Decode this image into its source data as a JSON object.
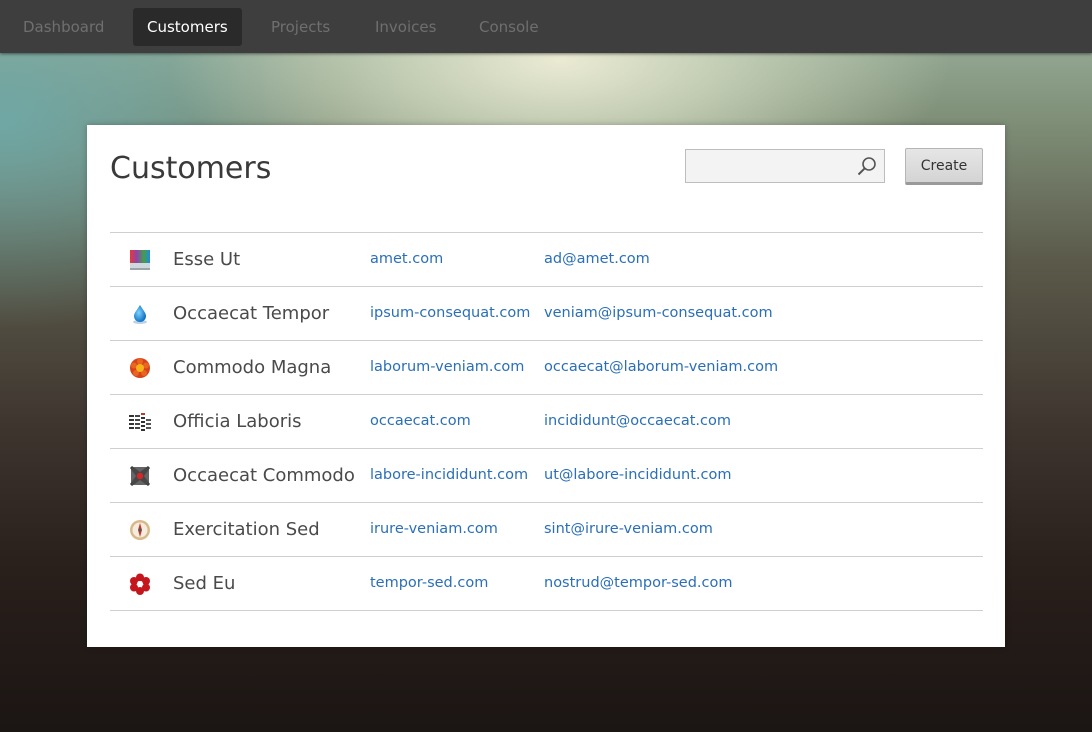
{
  "nav": {
    "items": [
      {
        "label": "Dashboard",
        "active": false
      },
      {
        "label": "Customers",
        "active": true
      },
      {
        "label": "Projects",
        "active": false
      },
      {
        "label": "Invoices",
        "active": false
      },
      {
        "label": "Console",
        "active": false
      }
    ]
  },
  "page": {
    "title": "Customers",
    "search": {
      "value": "",
      "placeholder": "",
      "icon": "search-icon"
    },
    "create_label": "Create"
  },
  "colors": {
    "link": "#2a6fb7",
    "nav_bg": "#3e3e3e",
    "nav_active_bg": "#2a2a2a"
  },
  "customers": [
    {
      "name": "Esse Ut",
      "website": "amet.com",
      "email": "ad@amet.com",
      "logo": "gradient-square-logo"
    },
    {
      "name": "Occaecat Tempor",
      "website": "ipsum-consequat.com",
      "email": "veniam@ipsum-consequat.com",
      "logo": "water-drop-logo"
    },
    {
      "name": "Commodo Magna",
      "website": "laborum-veniam.com",
      "email": "occaecat@laborum-veniam.com",
      "logo": "orange-flower-logo"
    },
    {
      "name": "Officia Laboris",
      "website": "occaecat.com",
      "email": "incididunt@occaecat.com",
      "logo": "equalizer-bars-logo"
    },
    {
      "name": "Occaecat Commodo",
      "website": "labore-incididunt.com",
      "email": "ut@labore-incididunt.com",
      "logo": "dark-x-logo"
    },
    {
      "name": "Exercitation Sed",
      "website": "irure-veniam.com",
      "email": "sint@irure-veniam.com",
      "logo": "compass-logo"
    },
    {
      "name": "Sed Eu",
      "website": "tempor-sed.com",
      "email": "nostrud@tempor-sed.com",
      "logo": "red-flower-logo"
    }
  ]
}
